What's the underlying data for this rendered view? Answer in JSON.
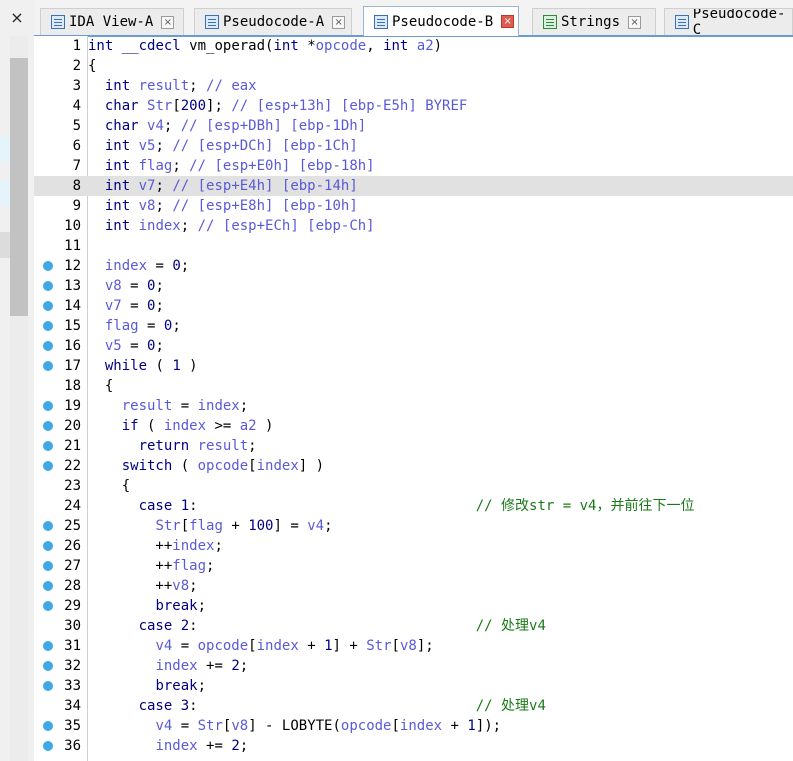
{
  "tabs": [
    {
      "label": "IDA View-A",
      "icon": "disassembly-icon",
      "active": false
    },
    {
      "label": "Pseudocode-A",
      "icon": "pseudocode-icon",
      "active": false
    },
    {
      "label": "Pseudocode-B",
      "icon": "pseudocode-icon",
      "active": true
    },
    {
      "label": "Strings",
      "icon": "strings-icon",
      "active": false
    },
    {
      "label": "Pseudocode-C",
      "icon": "pseudocode-icon",
      "active": false
    }
  ],
  "close_glyph": "×",
  "highlight_line": 8,
  "code_lines": [
    {
      "n": "1",
      "bp": false,
      "code": "int __cdecl vm_operad(int *opcode, int a2)"
    },
    {
      "n": "2",
      "bp": false,
      "code": "{"
    },
    {
      "n": "3",
      "bp": false,
      "code": "  int result; // eax"
    },
    {
      "n": "4",
      "bp": false,
      "code": "  char Str[200]; // [esp+13h] [ebp-E5h] BYREF"
    },
    {
      "n": "5",
      "bp": false,
      "code": "  char v4; // [esp+DBh] [ebp-1Dh]"
    },
    {
      "n": "6",
      "bp": false,
      "code": "  int v5; // [esp+DCh] [ebp-1Ch]"
    },
    {
      "n": "7",
      "bp": false,
      "code": "  int flag; // [esp+E0h] [ebp-18h]"
    },
    {
      "n": "8",
      "bp": false,
      "code": "  int v7; // [esp+E4h] [ebp-14h]"
    },
    {
      "n": "9",
      "bp": false,
      "code": "  int v8; // [esp+E8h] [ebp-10h]"
    },
    {
      "n": "10",
      "bp": false,
      "code": "  int index; // [esp+ECh] [ebp-Ch]"
    },
    {
      "n": "11",
      "bp": false,
      "code": ""
    },
    {
      "n": "12",
      "bp": true,
      "code": "  index = 0;"
    },
    {
      "n": "13",
      "bp": true,
      "code": "  v8 = 0;"
    },
    {
      "n": "14",
      "bp": true,
      "code": "  v7 = 0;"
    },
    {
      "n": "15",
      "bp": true,
      "code": "  flag = 0;"
    },
    {
      "n": "16",
      "bp": true,
      "code": "  v5 = 0;"
    },
    {
      "n": "17",
      "bp": true,
      "code": "  while ( 1 )"
    },
    {
      "n": "18",
      "bp": false,
      "code": "  {"
    },
    {
      "n": "19",
      "bp": true,
      "code": "    result = index;"
    },
    {
      "n": "20",
      "bp": true,
      "code": "    if ( index >= a2 )"
    },
    {
      "n": "21",
      "bp": true,
      "code": "      return result;"
    },
    {
      "n": "22",
      "bp": true,
      "code": "    switch ( opcode[index] )"
    },
    {
      "n": "23",
      "bp": false,
      "code": "    {"
    },
    {
      "n": "24",
      "bp": false,
      "code": "      case 1:                                 // 修改str = v4，并前往下一位"
    },
    {
      "n": "25",
      "bp": true,
      "code": "        Str[flag + 100] = v4;"
    },
    {
      "n": "26",
      "bp": true,
      "code": "        ++index;"
    },
    {
      "n": "27",
      "bp": true,
      "code": "        ++flag;"
    },
    {
      "n": "28",
      "bp": true,
      "code": "        ++v8;"
    },
    {
      "n": "29",
      "bp": true,
      "code": "        break;"
    },
    {
      "n": "30",
      "bp": false,
      "code": "      case 2:                                 // 处理v4"
    },
    {
      "n": "31",
      "bp": true,
      "code": "        v4 = opcode[index + 1] + Str[v8];"
    },
    {
      "n": "32",
      "bp": true,
      "code": "        index += 2;"
    },
    {
      "n": "33",
      "bp": true,
      "code": "        break;"
    },
    {
      "n": "34",
      "bp": false,
      "code": "      case 3:                                 // 处理v4"
    },
    {
      "n": "35",
      "bp": true,
      "code": "        v4 = Str[v8] - LOBYTE(opcode[index + 1]);"
    },
    {
      "n": "36",
      "bp": true,
      "code": "        index += 2;"
    }
  ]
}
